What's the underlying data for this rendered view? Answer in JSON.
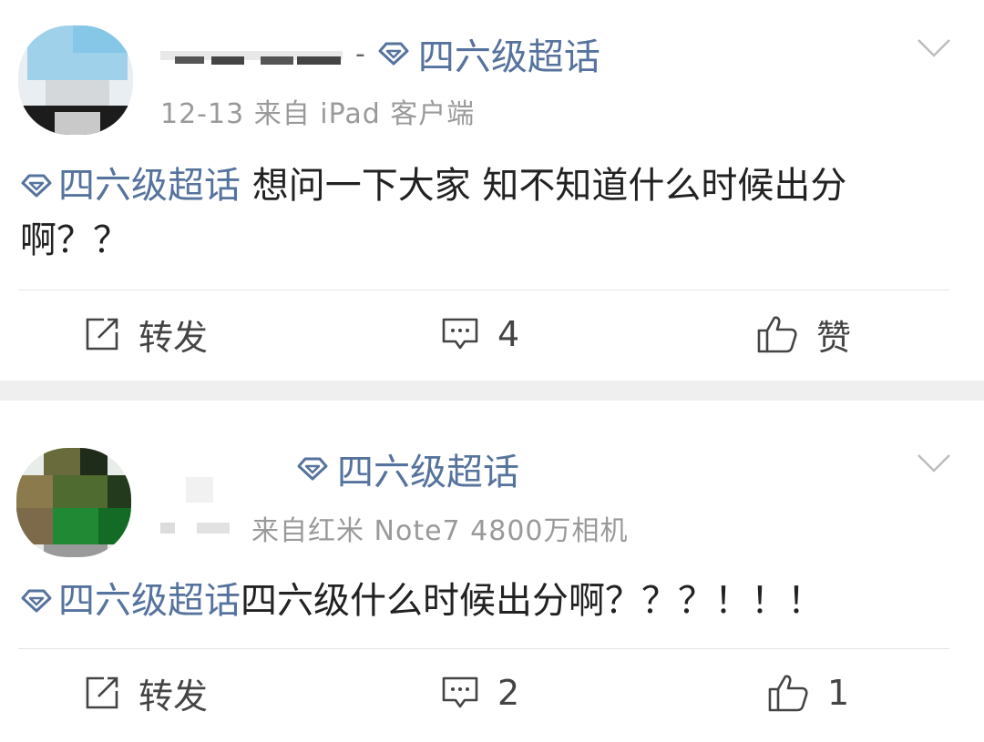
{
  "colors": {
    "topic": "#56739e",
    "meta": "#9a9a9a",
    "text": "#222222",
    "separator": "#efefef"
  },
  "posts": [
    {
      "username_separator": "-",
      "topic_label": "四六级超话",
      "meta": "12-13  来自 iPad 客户端",
      "content_tag": "四六级超话",
      "content_text": " 想问一下大家 知不知道什么时候出分啊？？",
      "actions": {
        "repost": "转发",
        "comment": "4",
        "like": "赞"
      },
      "icons": [
        "diamond-icon",
        "chevron-down-icon",
        "repost-icon",
        "comment-icon",
        "like-icon"
      ]
    },
    {
      "topic_label": "四六级超话",
      "meta": "来自红米 Note7 4800万相机",
      "content_tag": "四六级超话",
      "content_text": "四六级什么时候出分啊？？？！！！",
      "actions": {
        "repost": "转发",
        "comment": "2",
        "like": "1"
      },
      "icons": [
        "diamond-icon",
        "chevron-down-icon",
        "repost-icon",
        "comment-icon",
        "like-icon"
      ]
    }
  ]
}
